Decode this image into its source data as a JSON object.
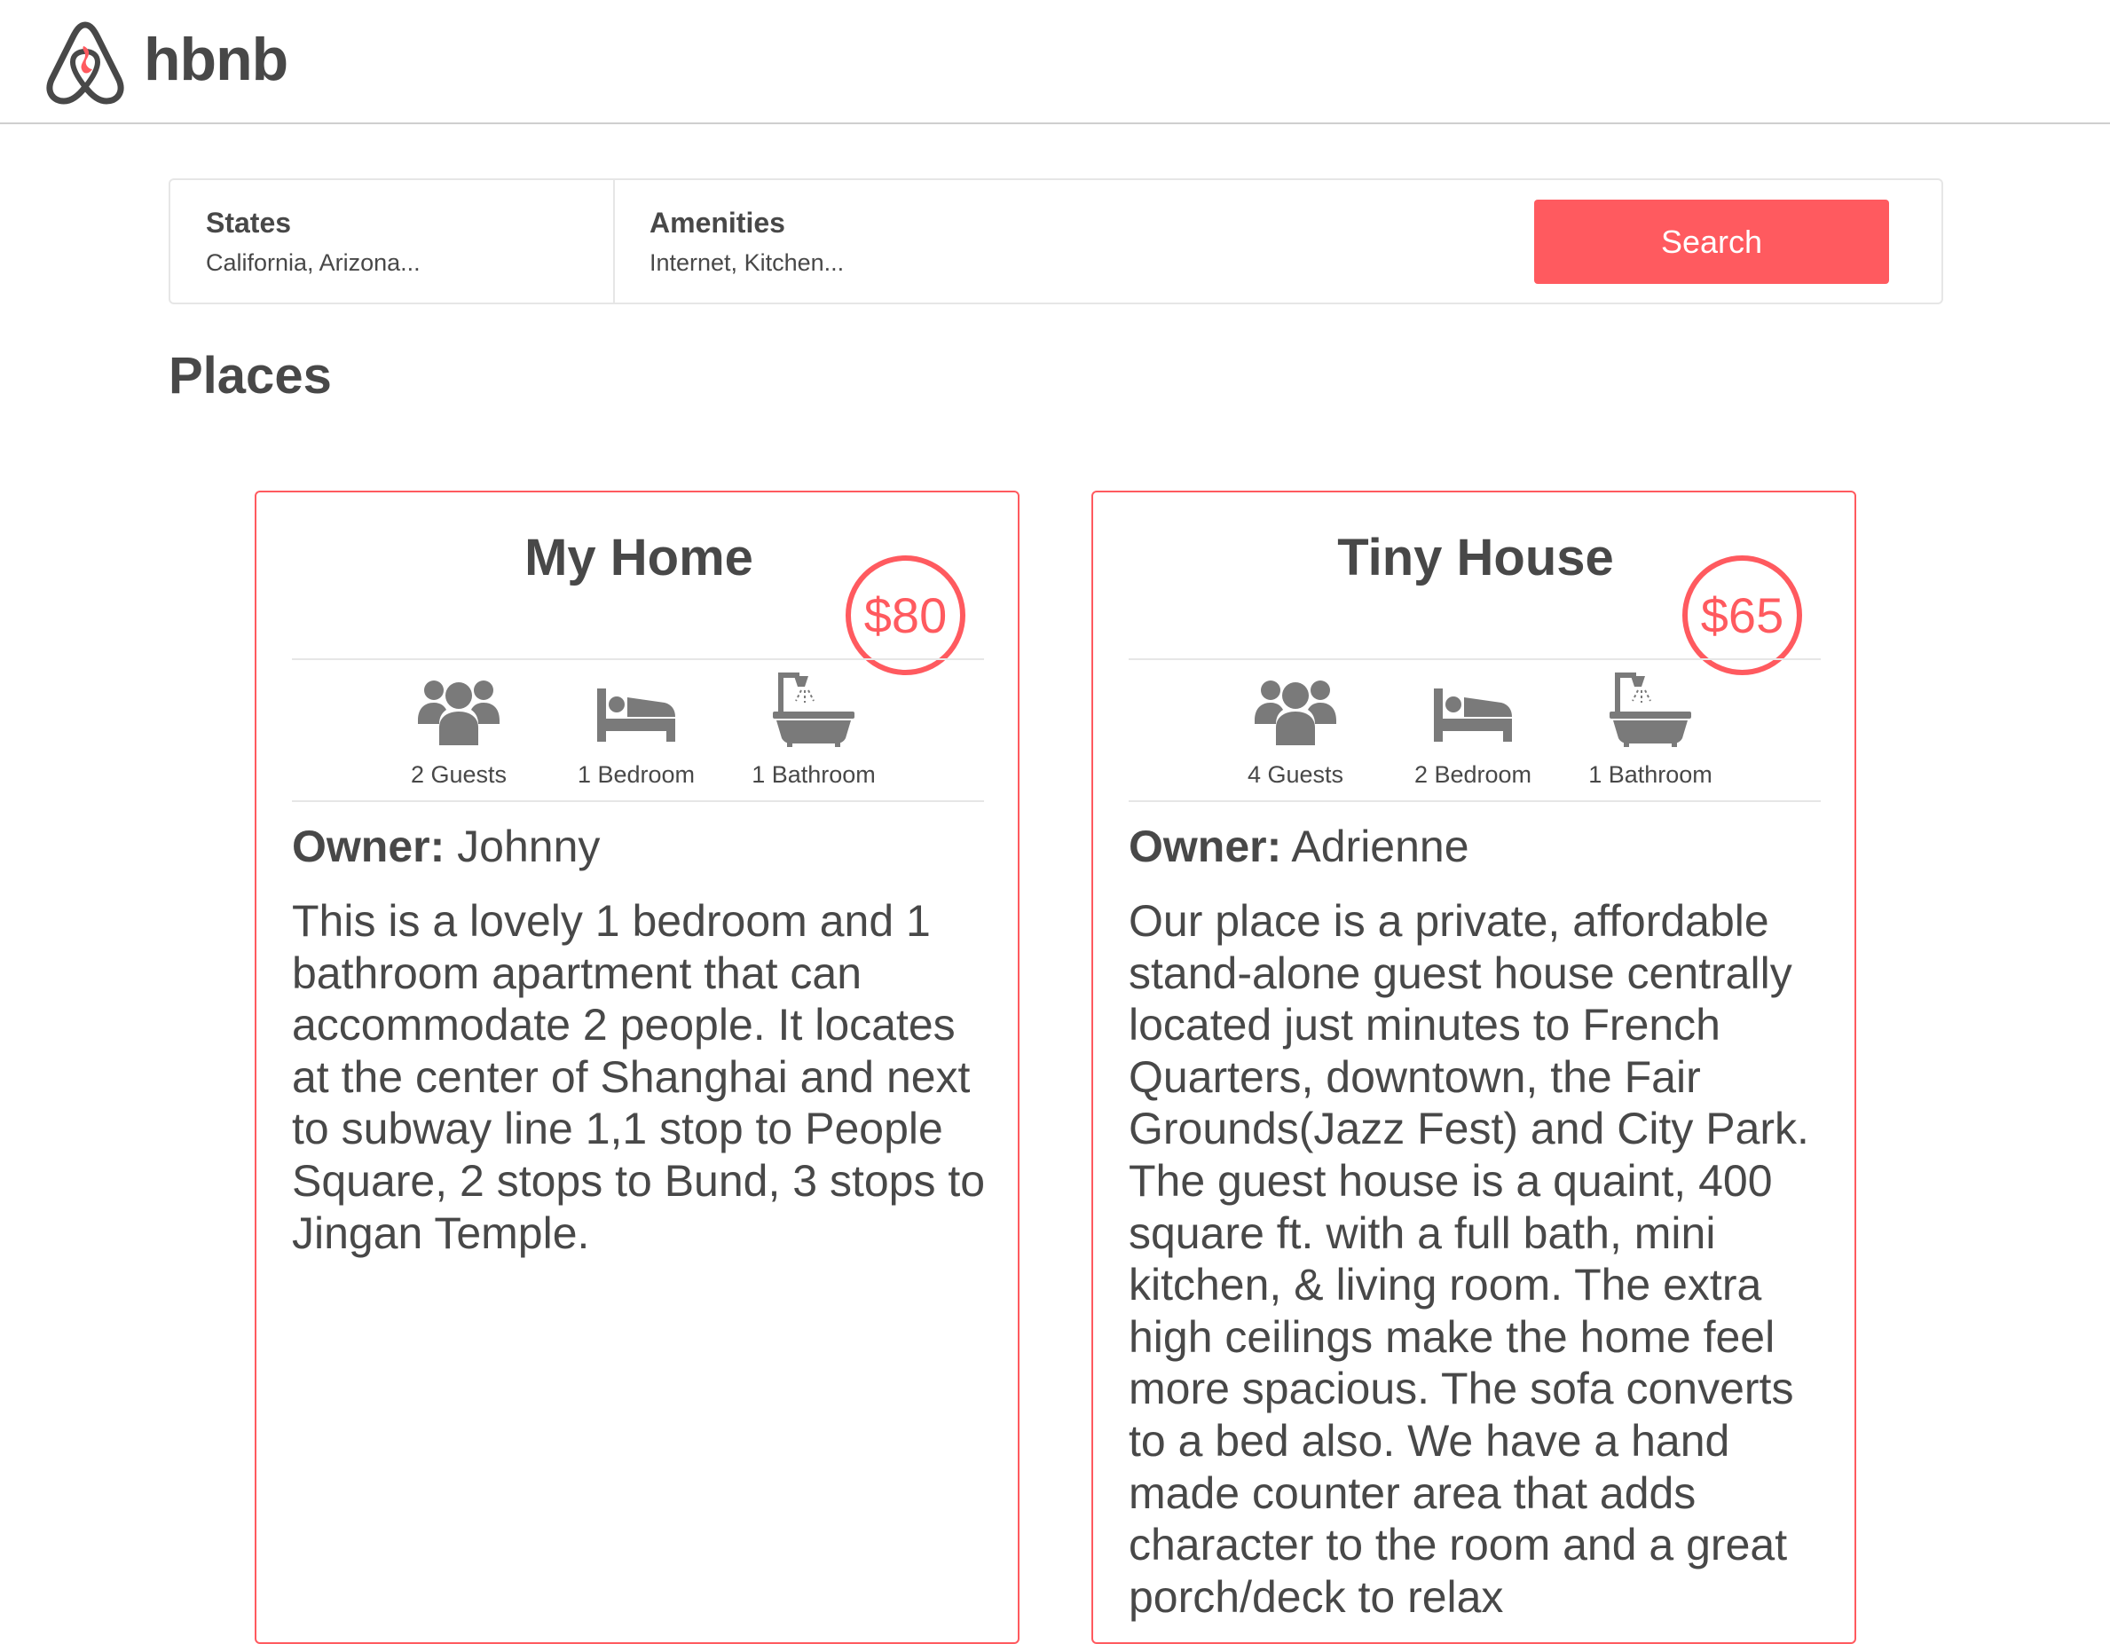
{
  "header": {
    "brand": "hbnb",
    "accent_color": "#ff5a5f"
  },
  "filters": {
    "states": {
      "title": "States",
      "value": "California, Arizona..."
    },
    "amenities": {
      "title": "Amenities",
      "value": "Internet, Kitchen..."
    },
    "search_label": "Search"
  },
  "places": {
    "title": "Places",
    "items": [
      {
        "name": "My Home",
        "price": "$80",
        "guests": "2 Guests",
        "rooms": "1 Bedroom",
        "baths": "1 Bathroom",
        "owner_label": "Owner:",
        "owner": "Johnny",
        "description": "This is a lovely 1 bedroom and 1 bathroom apartment that can accommodate 2 people. It locates at the center of Shanghai and next to subway line 1,1 stop to People Square, 2 stops to Bund, 3 stops to Jingan Temple."
      },
      {
        "name": "Tiny House",
        "price": "$65",
        "guests": "4 Guests",
        "rooms": "2 Bedroom",
        "baths": "1 Bathroom",
        "owner_label": "Owner:",
        "owner": "Adrienne",
        "description": "Our place is a private, affordable stand-alone guest house centrally located just minutes to French Quarters, downtown, the Fair Grounds(Jazz Fest) and City Park. The guest house is a quaint, 400 square ft. with a full bath, mini kitchen, & living room. The extra high ceilings make the home feel more spacious. The sofa converts to a bed also. We have a hand made counter area that adds character to the room and a great porch/deck to relax"
      }
    ]
  },
  "icons": {
    "logo": "hbnb-logo-icon",
    "guests": "guests-icon",
    "rooms": "bed-icon",
    "baths": "bathtub-icon"
  }
}
